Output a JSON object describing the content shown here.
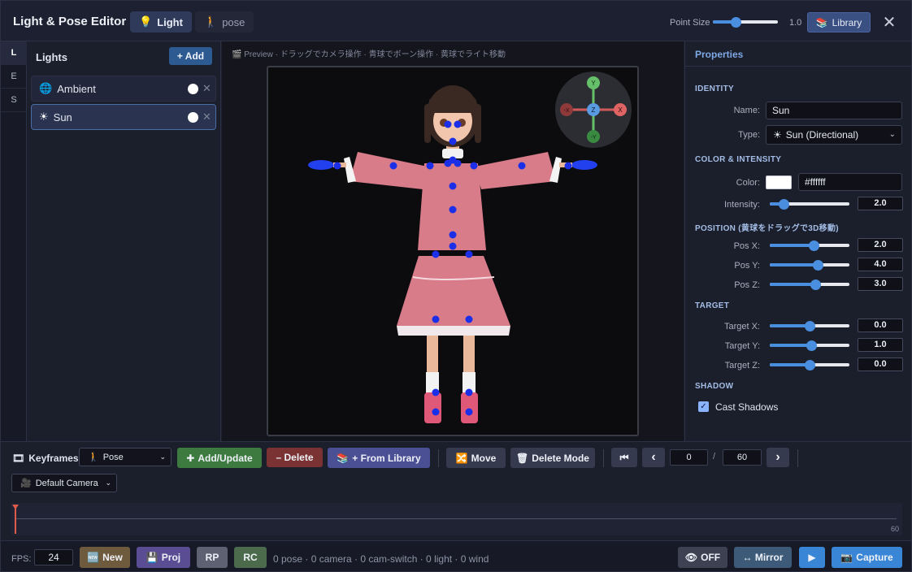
{
  "colors": {
    "accent": "#4a8ee0",
    "add_green": "#3d7a3f",
    "delete_red": "#7a3232",
    "library_purple": "#4b4f94",
    "capture_blue": "#3a86d6",
    "joint_blue": "#1c2fe8"
  },
  "titlebar": {
    "title": "Light & Pose Editor",
    "tabs": [
      {
        "label": "Light",
        "icon": "bulb-icon",
        "active": true
      },
      {
        "label": "pose",
        "icon": "walking-figure-icon",
        "active": false
      }
    ],
    "point_size_label": "Point Size",
    "point_size_value": "1.0",
    "point_size_fraction": 0.35,
    "library_label": "Library",
    "close_label": "✕"
  },
  "side_tabs": [
    "L",
    "E",
    "S"
  ],
  "lights_panel": {
    "title": "Lights",
    "add_label": "+ Add",
    "items": [
      {
        "name": "Ambient",
        "icon": "globe-icon",
        "selected": false
      },
      {
        "name": "Sun",
        "icon": "sun-icon",
        "selected": true
      }
    ],
    "delete_glyph": "✕"
  },
  "preview": {
    "caption": "Preview · ドラッグでカメラ操作 · 青球でボーン操作 · 黄球でライト移動",
    "gizmo_labels": {
      "up": "Y",
      "down": "-Y",
      "left": "-X",
      "right": "X",
      "center": "Z"
    }
  },
  "properties": {
    "title": "Properties",
    "identity": {
      "section": "IDENTITY",
      "name_label": "Name:",
      "name_value": "Sun",
      "type_label": "Type:",
      "type_value": "Sun (Directional)"
    },
    "color_intensity": {
      "section": "COLOR & INTENSITY",
      "color_label": "Color:",
      "color_value": "#ffffff",
      "intensity_label": "Intensity:",
      "intensity_value": "2.0",
      "intensity_fraction": 0.17
    },
    "position": {
      "section": "POSITION (黄球をドラッグで3D移動)",
      "fields": [
        {
          "label": "Pos X:",
          "value": "2.0",
          "fraction": 0.55
        },
        {
          "label": "Pos Y:",
          "value": "4.0",
          "fraction": 0.6
        },
        {
          "label": "Pos Z:",
          "value": "3.0",
          "fraction": 0.57
        }
      ]
    },
    "target": {
      "section": "TARGET",
      "fields": [
        {
          "label": "Target X:",
          "value": "0.0",
          "fraction": 0.5
        },
        {
          "label": "Target Y:",
          "value": "1.0",
          "fraction": 0.52
        },
        {
          "label": "Target Z:",
          "value": "0.0",
          "fraction": 0.5
        }
      ]
    },
    "shadow": {
      "section": "SHADOW",
      "cast_label": "Cast Shadows",
      "cast_checked": true,
      "check_glyph": "✓"
    }
  },
  "keyframes": {
    "label": "Keyframes",
    "mode_select": "Pose",
    "add_update": "Add/Update",
    "delete": "– Delete",
    "from_library": "+ From Library",
    "move": "Move",
    "delete_mode": "Delete Mode",
    "first_glyph": "⏮",
    "prev_glyph": "‹",
    "next_glyph": "›",
    "current_frame": "0",
    "separator": "/",
    "total_frames": "60",
    "camera_select": "Default Camera"
  },
  "timeline": {
    "end_label": "60",
    "playhead": 0
  },
  "bottom": {
    "fps_label": "FPS:",
    "fps_value": "24",
    "new_label": "New",
    "proj_label": "Proj",
    "rp_label": "RP",
    "rc_label": "RC",
    "status": "0 pose · 0 camera · 0 cam-switch · 0 light · 0 wind",
    "off_label": "OFF",
    "mirror_label": "↔ Mirror",
    "play_glyph": "▶",
    "capture_label": "Capture"
  }
}
